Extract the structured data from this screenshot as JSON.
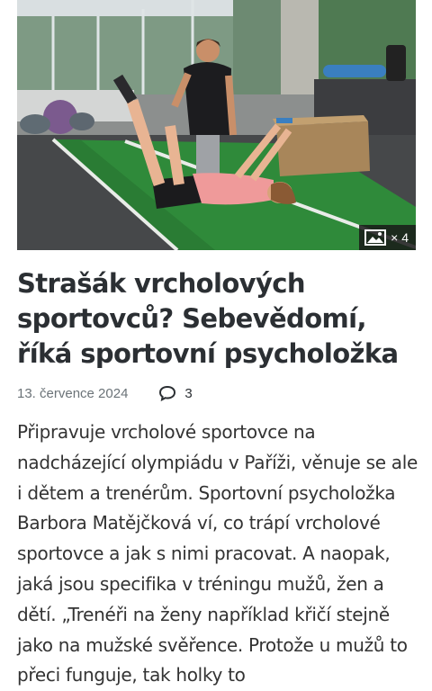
{
  "article": {
    "gallery_count": "× 4",
    "title": "Strašák vrcholových sportovců? Sebevědomí, říká sportovní psycholožka",
    "date": "13. července 2024",
    "comment_count": "3",
    "perex": "Připravuje vrcholové sportovce na nadcházející olympiádu v Paříži, věnuje se ale i dětem a trenérům. Sportovní psycholožka Barbora Matějčková ví, co trápí vrcholové sportovce a jak s nimi pracovat. A naopak, jaká jsou specifika v tréningu mužů, žen a dětí. „Trenéři na ženy například křičí stejně jako na mužské svěřence. Protože u mužů to přeci funguje, tak holky to"
  },
  "icons": {
    "gallery": "image-gallery-icon",
    "comments": "comment-bubble-icon"
  },
  "colors": {
    "title": "#2b2f33",
    "text": "#333333",
    "meta": "#6b7378",
    "turf": "#2f8a3a"
  }
}
